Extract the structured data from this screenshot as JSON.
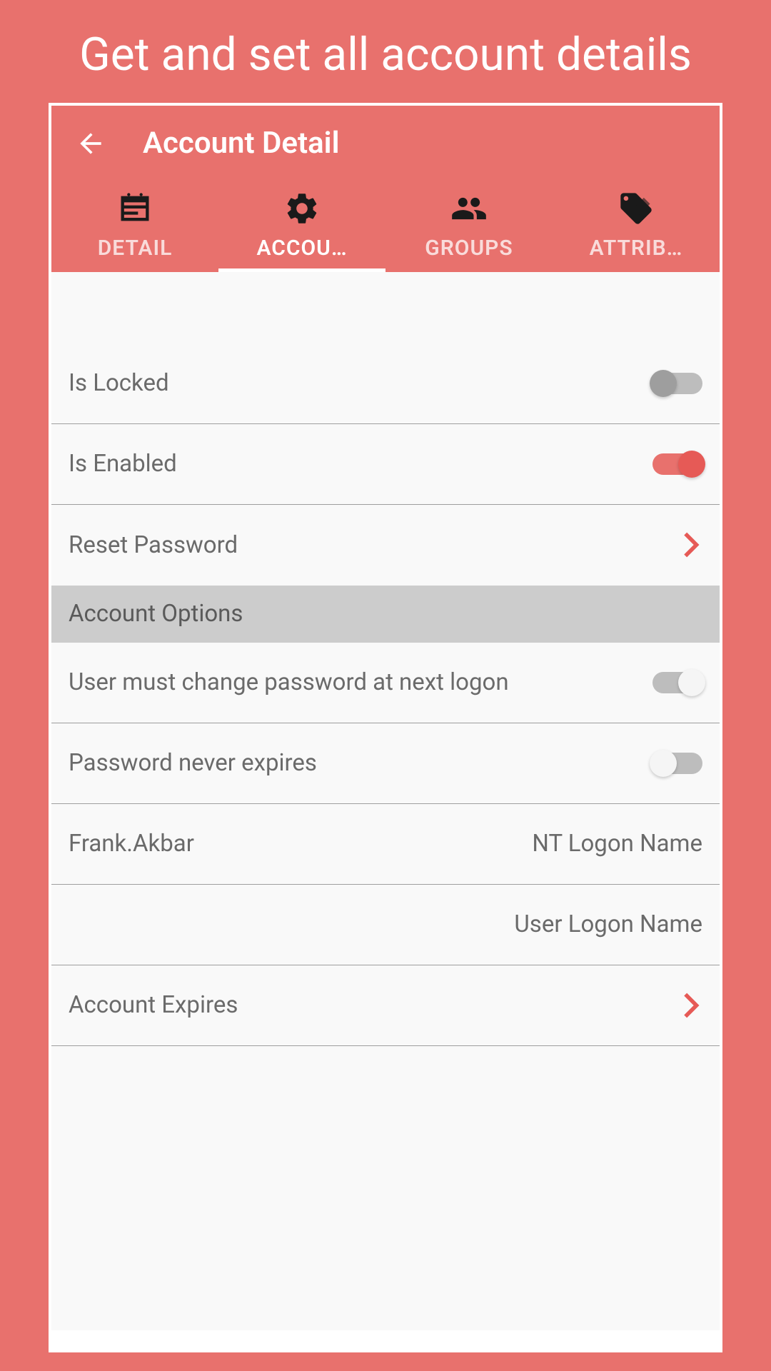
{
  "promo": {
    "title": "Get and set all account details"
  },
  "header": {
    "title": "Account Detail"
  },
  "tabs": [
    {
      "label": "DETAIL",
      "icon": "id-card"
    },
    {
      "label": "ACCOU…",
      "icon": "gear",
      "active": true
    },
    {
      "label": "GROUPS",
      "icon": "users"
    },
    {
      "label": "ATTRIB…",
      "icon": "tags"
    }
  ],
  "settings": {
    "is_locked": {
      "label": "Is Locked",
      "value": false
    },
    "is_enabled": {
      "label": "Is Enabled",
      "value": true
    },
    "reset_password": {
      "label": "Reset Password"
    },
    "section_account_options": {
      "label": "Account Options"
    },
    "must_change_password": {
      "label": "User must change password at next logon",
      "value": false
    },
    "password_never_expires": {
      "label": "Password never expires",
      "value": false
    },
    "nt_logon": {
      "label": "Frank.Akbar",
      "caption": "NT Logon Name"
    },
    "user_logon": {
      "label": "",
      "caption": "User Logon Name"
    },
    "account_expires": {
      "label": "Account Expires"
    }
  },
  "colors": {
    "accent": "#e8716d",
    "accent_dark": "#e65a56"
  }
}
